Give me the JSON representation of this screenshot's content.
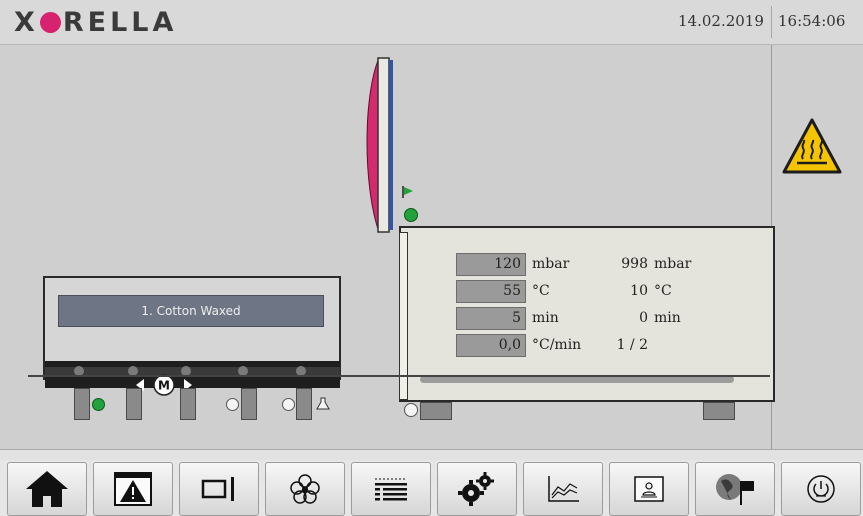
{
  "header": {
    "logo": "XORELLA",
    "date": "14.02.2019",
    "time": "16:54:06"
  },
  "colors": {
    "brand_accent": "#d6226f",
    "warning_yellow": "#f5c400",
    "status_green": "#22a23a",
    "program_label_bg": "#6e7584"
  },
  "left_unit": {
    "program_label": "1. Cotton Waxed",
    "motor_label": "M"
  },
  "furnace": {
    "rows": [
      {
        "setpoint": "120",
        "setpoint_unit": "mbar",
        "actual": "998",
        "actual_unit": "mbar"
      },
      {
        "setpoint": "55",
        "setpoint_unit": "°C",
        "actual": "10",
        "actual_unit": "°C"
      },
      {
        "setpoint": "5",
        "setpoint_unit": "min",
        "actual": "0",
        "actual_unit": "min"
      },
      {
        "setpoint": "0,0",
        "setpoint_unit": "°C/min",
        "actual": "1 / 2",
        "actual_unit": ""
      }
    ],
    "progress_fraction": 0.0
  },
  "warning": {
    "icon": "hot-surface-warning-icon"
  },
  "nav": [
    {
      "name": "home",
      "icon": "home-icon"
    },
    {
      "name": "alarms",
      "icon": "alarm-warning-icon"
    },
    {
      "name": "window",
      "icon": "window-panel-icon"
    },
    {
      "name": "recipes",
      "icon": "flower-recipe-icon"
    },
    {
      "name": "list",
      "icon": "list-icon"
    },
    {
      "name": "settings",
      "icon": "gears-icon"
    },
    {
      "name": "trend",
      "icon": "trend-chart-icon"
    },
    {
      "name": "user",
      "icon": "user-panel-icon"
    },
    {
      "name": "language",
      "icon": "globe-flag-icon"
    },
    {
      "name": "power",
      "icon": "power-icon"
    }
  ]
}
